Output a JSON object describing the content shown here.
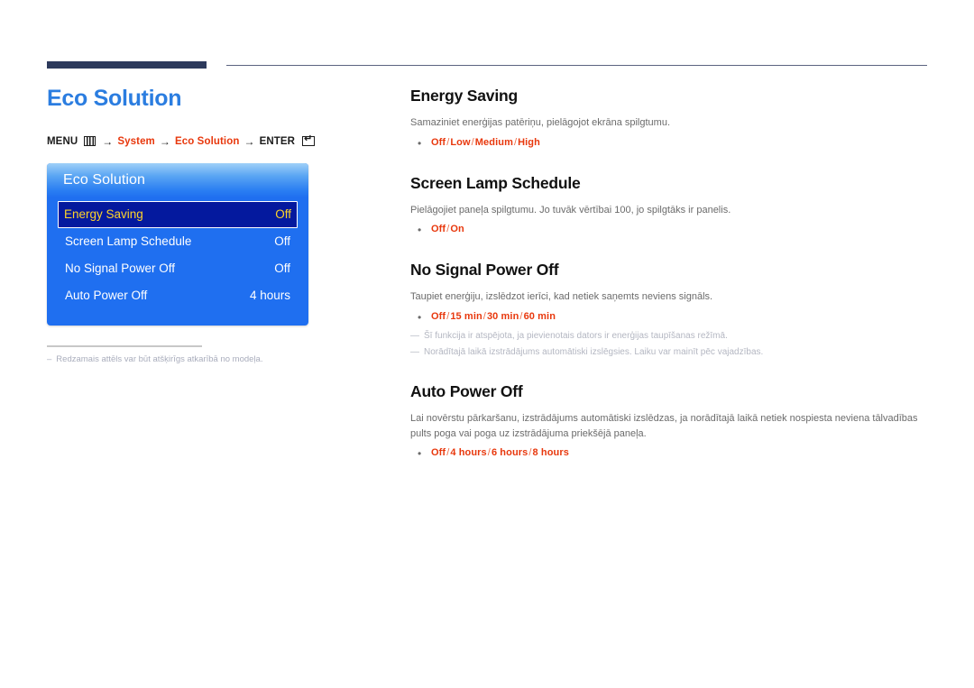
{
  "page_title": "Eco Solution",
  "breadcrumb": {
    "menu_label": "MENU",
    "menu_icon": "menu-grid-icon",
    "arrow": "→",
    "item1": "System",
    "item2": "Eco Solution",
    "enter_label": "ENTER",
    "enter_icon": "enter-key-icon"
  },
  "osd": {
    "title": "Eco Solution",
    "rows": [
      {
        "label": "Energy Saving",
        "value": "Off",
        "selected": true
      },
      {
        "label": "Screen Lamp Schedule",
        "value": "Off",
        "selected": false
      },
      {
        "label": "No Signal Power Off",
        "value": "Off",
        "selected": false
      },
      {
        "label": "Auto Power Off",
        "value": "4 hours",
        "selected": false
      }
    ]
  },
  "left_note": {
    "dash": "–",
    "text": "Redzamais attēls var būt atšķirīgs atkarībā no modeļa."
  },
  "sections": [
    {
      "title": "Energy Saving",
      "desc": "Samaziniet enerģijas patēriņu, pielāgojot ekrāna spilgtumu.",
      "bullet": "•",
      "options": [
        "Off",
        "Low",
        "Medium",
        "High"
      ],
      "notes": []
    },
    {
      "title": "Screen Lamp Schedule",
      "desc": "Pielāgojiet paneļa spilgtumu. Jo tuvāk vērtībai 100, jo spilgtāks ir panelis.",
      "bullet": "•",
      "options": [
        "Off",
        "On"
      ],
      "notes": []
    },
    {
      "title": "No Signal Power Off",
      "desc": "Taupiet enerģiju, izslēdzot ierīci, kad netiek saņemts neviens signāls.",
      "bullet": "•",
      "options": [
        "Off",
        "15 min",
        "30 min",
        "60 min"
      ],
      "notes": [
        "Šī funkcija ir atspējota, ja pievienotais dators ir enerģijas taupīšanas režīmā.",
        "Norādītajā laikā izstrādājums automātiski izslēgsies. Laiku var mainīt pēc vajadzības."
      ]
    },
    {
      "title": "Auto Power Off",
      "desc": "Lai novērstu pārkaršanu, izstrādājums automātiski izslēdzas, ja norādītajā laikā netiek nospiesta neviena tālvadības pults poga vai poga uz izstrādājuma priekšējā paneļa.",
      "bullet": "•",
      "options": [
        "Off",
        "4 hours",
        "6 hours",
        "8 hours"
      ],
      "notes": []
    }
  ],
  "note_marker": "—",
  "colors": {
    "title_blue": "#2b7de0",
    "accent_red": "#e8380d",
    "osd_blue": "#1f6ff0",
    "osd_selected": "#04199e",
    "osd_selected_text": "#ffd42a",
    "rule_navy": "#2d3a5c"
  }
}
